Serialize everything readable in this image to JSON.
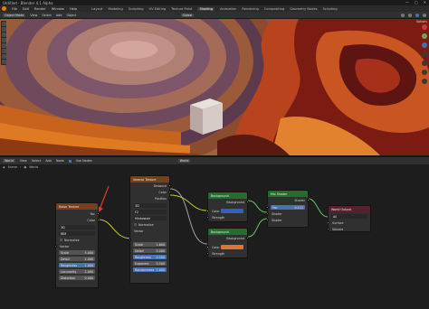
{
  "window": {
    "title": "Untitled - Blender 4.1 Alpha",
    "controls": [
      "—",
      "▢",
      "✕"
    ]
  },
  "menu": {
    "items": [
      "File",
      "Edit",
      "Render",
      "Window",
      "Help"
    ],
    "workspaces": [
      "Layout",
      "Modeling",
      "Sculpting",
      "UV Editing",
      "Texture Paint",
      "Shading",
      "Animation",
      "Rendering",
      "Compositing",
      "Geometry Nodes",
      "Scripting"
    ],
    "active_workspace": "Shading"
  },
  "viewport_header": {
    "mode": "Object Mode",
    "menus": [
      "View",
      "Select",
      "Add",
      "Object"
    ],
    "transform": "Global",
    "options_label": "Options"
  },
  "node_header": {
    "editor_type": "World",
    "menus": [
      "View",
      "Select",
      "Add",
      "Node"
    ],
    "use_nodes_label": "Use Nodes",
    "world_name": "World"
  },
  "breadcrumb": {
    "scene": "Scene",
    "world": "World"
  },
  "colors": {
    "texture_header": "#783e1f",
    "shader_header": "#236d2e",
    "output_header": "#5a1f2c",
    "background_top_color": "#2f62b8",
    "background_bottom_color": "#e0742f",
    "annotation_arrow": "#e23a2b"
  },
  "nodes": {
    "noise": {
      "title": "Noise Texture",
      "out_fac": "Fac",
      "out_color": "Color",
      "dimension": "3D",
      "type": "fBM",
      "normalize": "Normalize",
      "vector": "Vector",
      "scale_label": "Scale",
      "scale": "5.000",
      "detail_label": "Detail",
      "detail": "2.000",
      "roughness_label": "Roughness",
      "roughness": "1.000",
      "lacunarity_label": "Lacunarity",
      "lacunarity": "2.000",
      "distortion_label": "Distortion",
      "distortion": "0.000"
    },
    "voronoi": {
      "title": "Voronoi Texture",
      "out_distance": "Distance",
      "out_color": "Color",
      "out_position": "Position",
      "dimension": "3D",
      "feature": "F2",
      "metric": "Minkowski",
      "normalize": "Normalize",
      "vector": "Vector",
      "scale_label": "Scale",
      "scale": "1.600",
      "detail_label": "Detail",
      "detail": "0.000",
      "roughness_label": "Roughness",
      "roughness": "0.500",
      "exponent_label": "Exponent",
      "exponent": "0.500",
      "randomness_label": "Randomness",
      "randomness": "1.000"
    },
    "bg1": {
      "title": "Background",
      "out": "Background",
      "color": "Color",
      "strength": "Strength"
    },
    "bg2": {
      "title": "Background",
      "out": "Background",
      "color": "Color",
      "strength": "Strength"
    },
    "mix": {
      "title": "Mix Shader",
      "out": "Shader",
      "fac_label": "Fac",
      "fac": "0.112",
      "shader1": "Shader",
      "shader2": "Shader"
    },
    "output": {
      "title": "World Output",
      "target": "All",
      "surface": "Surface",
      "volume": "Volume"
    }
  }
}
